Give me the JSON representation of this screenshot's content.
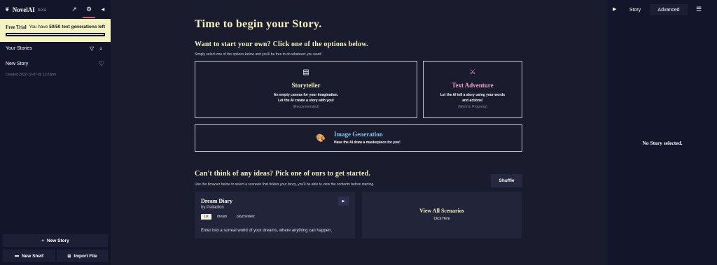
{
  "app": {
    "name": "NovelAI",
    "badge": "beta"
  },
  "trial": {
    "label": "Free Trial",
    "prefix": "You have ",
    "count": "50/50",
    "suffix": " text generations left",
    "remaining_fraction": 1.0
  },
  "sidebar": {
    "section_title": "Your Stories",
    "stories": [
      {
        "name": "New Story",
        "created": "Created 2022-12-07 @ 12:23pm"
      }
    ],
    "new_story_label": "New Story",
    "new_shelf_label": "New Shelf",
    "import_file_label": "Import File"
  },
  "main": {
    "title": "Time to begin your Story.",
    "heading1": "Want to start your own? Click one of the options below.",
    "sub1": "Simply select one of the options below and you'll be free to do whatever you want!",
    "cards": {
      "storyteller": {
        "title": "Storyteller",
        "desc1": "An empty canvas for your imagination.",
        "desc2": "Let the AI create a story with you!",
        "note": "(Recommended)"
      },
      "text_adventure": {
        "title": "Text Adventure",
        "desc1": "Let the AI tell a story using your words",
        "desc2": "and actions!",
        "note": "(Work in Progress)"
      },
      "image_generation": {
        "title": "Image Generation",
        "desc": "Have the AI draw a masterpiece for you!"
      }
    },
    "heading2": "Can't think of any ideas? Pick one of ours to get started.",
    "sub2": "Use the browser below to select a scenario that tickles your fancy, you'll be able to view the contents before starting.",
    "shuffle_label": "Shuffle",
    "scenario": {
      "name": "Dream Diary",
      "author": "by Palladion",
      "tags": [
        "1st",
        "dream",
        "psychedelic"
      ],
      "desc": "Enter into a surreal world of your dreams, where anything can happen."
    },
    "view_all": {
      "title": "View All Scenarios",
      "sub": "Click Here"
    }
  },
  "right": {
    "tabs": [
      "Story",
      "Advanced"
    ],
    "active_tab": "Advanced",
    "empty_text": "No Story selected."
  },
  "colors": {
    "accent_cream": "#f5f3c2",
    "accent_blue": "#84c2f2",
    "accent_pink": "#f0a5c6",
    "active_underline": "#e8505b",
    "bg": "#1a1c2e"
  }
}
